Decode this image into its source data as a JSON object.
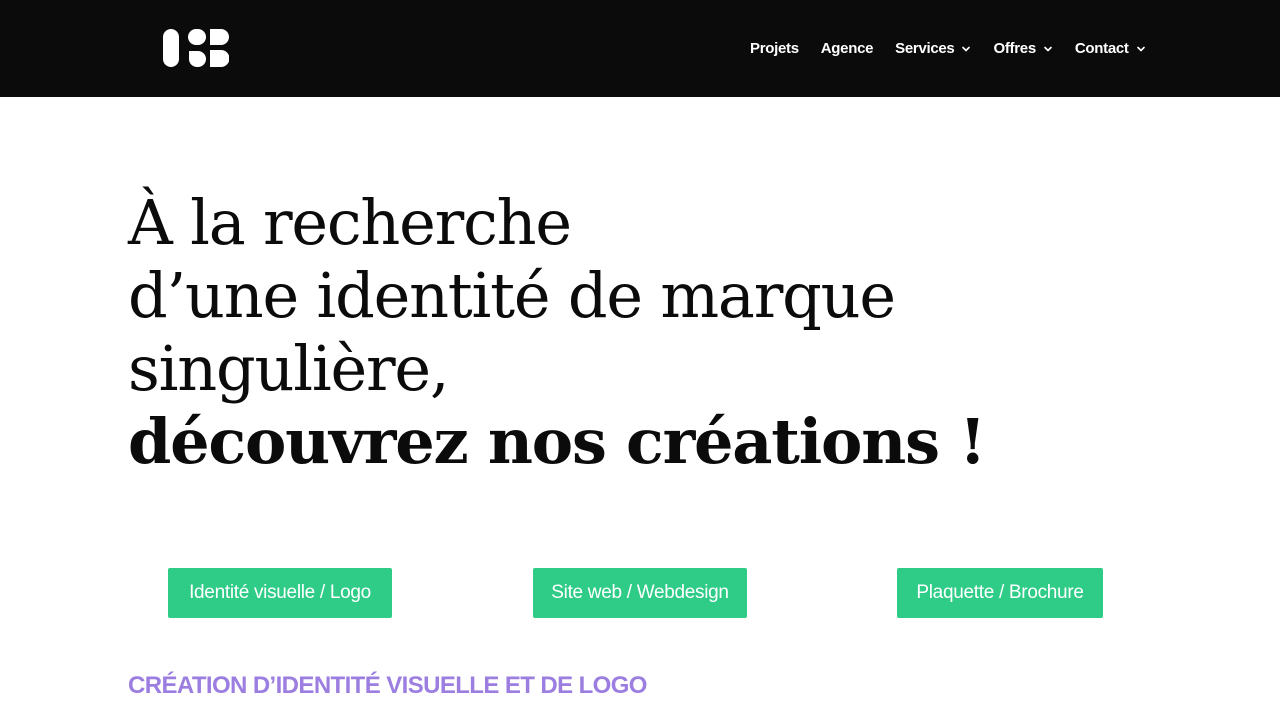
{
  "header": {
    "logo_icon": "osb-monogram-logo",
    "nav": [
      {
        "label": "Projets",
        "has_dropdown": false
      },
      {
        "label": "Agence",
        "has_dropdown": false
      },
      {
        "label": "Services",
        "has_dropdown": true
      },
      {
        "label": "Offres",
        "has_dropdown": true
      },
      {
        "label": "Contact",
        "has_dropdown": true
      }
    ],
    "dropdown_icon": "chevron-down-icon"
  },
  "hero": {
    "line1": "À la recherche",
    "line2": "d’une identité de marque",
    "line3": "singulière,",
    "line4": "découvrez nos créations !"
  },
  "buttons": {
    "identity": "Identité visuelle / Logo",
    "web": "Site web / Webdesign",
    "brochure": "Plaquette / Brochure"
  },
  "section": {
    "title": "CRÉATION D’IDENTITÉ VISUELLE ET DE LOGO"
  },
  "colors": {
    "header_bg": "#0b0b0b",
    "accent_green": "#2ecc87",
    "accent_purple": "#9b7ee0",
    "text_dark": "#0b0b0b"
  }
}
